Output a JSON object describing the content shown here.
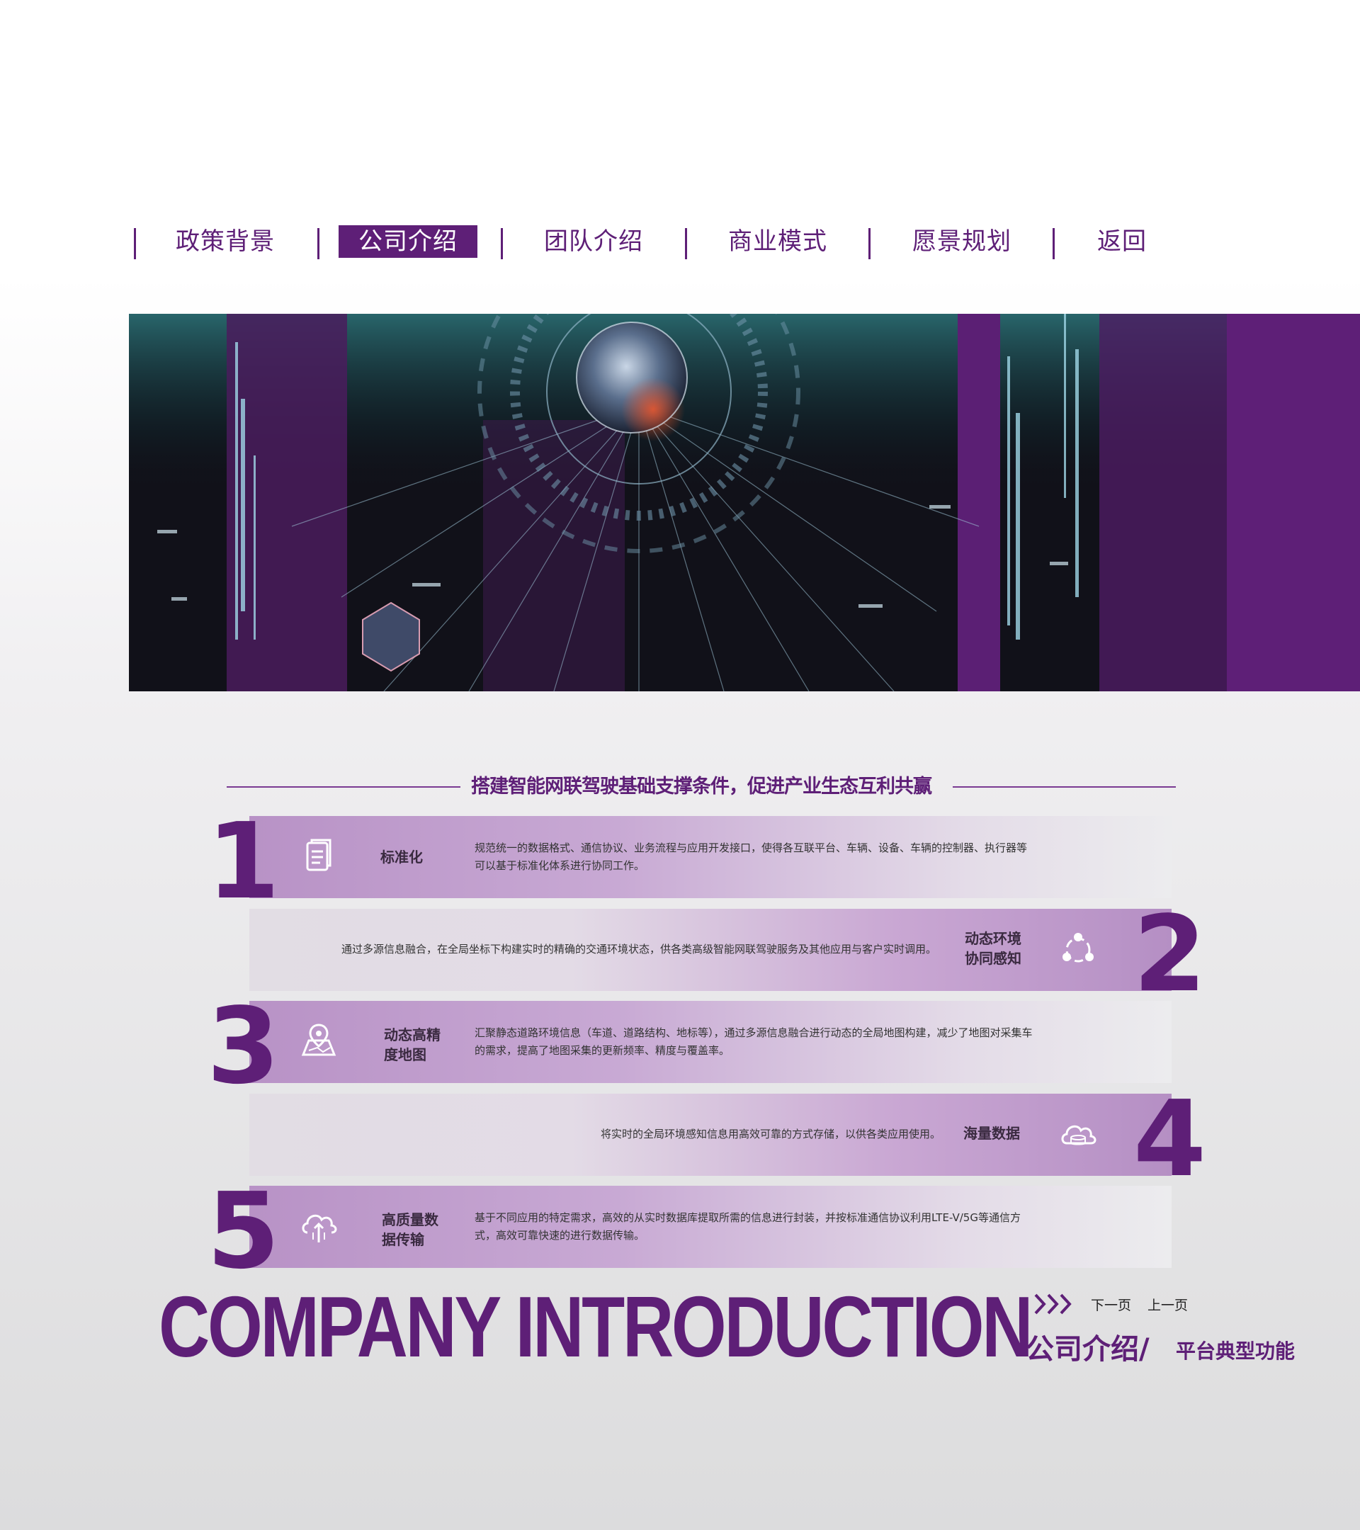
{
  "nav": {
    "items": [
      {
        "label": "政策背景",
        "active": false
      },
      {
        "label": "公司介绍",
        "active": true
      },
      {
        "label": "团队介绍",
        "active": false
      },
      {
        "label": "商业模式",
        "active": false
      },
      {
        "label": "愿景规划",
        "active": false
      },
      {
        "label": "返回",
        "active": false
      }
    ]
  },
  "section": {
    "heading": "搭建智能网联驾驶基础支撑条件，促进产业生态互利共赢"
  },
  "features": [
    {
      "number": "1",
      "title": "标准化",
      "icon": "document-icon",
      "desc": "规范统一的数据格式、通信协议、业务流程与应用开发接口，使得各互联平台、车辆、设备、车辆的控制器、执行器等可以基于标准化体系进行协同工作。"
    },
    {
      "number": "2",
      "title": "动态环境协同感知",
      "icon": "network-nodes-icon",
      "desc": "通过多源信息融合，在全局坐标下构建实时的精确的交通环境状态，供各类高级智能网联驾驶服务及其他应用与客户实时调用。"
    },
    {
      "number": "3",
      "title": "动态高精度地图",
      "icon": "map-pin-icon",
      "desc": "汇聚静态道路环境信息（车道、道路结构、地标等），通过多源信息融合进行动态的全局地图构建，减少了地图对采集车的需求，提高了地图采集的更新频率、精度与覆盖率。"
    },
    {
      "number": "4",
      "title": "海量数据",
      "icon": "cloud-database-icon",
      "desc": "将实时的全局环境感知信息用高效可靠的方式存储，以供各类应用使用。"
    },
    {
      "number": "5",
      "title": "高质量数据传输",
      "icon": "cloud-upload-icon",
      "desc": "基于不同应用的特定需求，高效的从实时数据库提取所需的信息进行封装，并按标准通信协议利用LTE-V/5G等通信方式，高效可靠快速的进行数据传输。"
    }
  ],
  "footer": {
    "big_title": "COMPANY INTRODUCTION",
    "next_label": "下一页",
    "prev_label": "上一页",
    "subtitle_main": "公司介绍/",
    "subtitle_sub": "平台典型功能"
  },
  "colors": {
    "brand_purple": "#5e1f77",
    "row_light": "#ececee"
  }
}
